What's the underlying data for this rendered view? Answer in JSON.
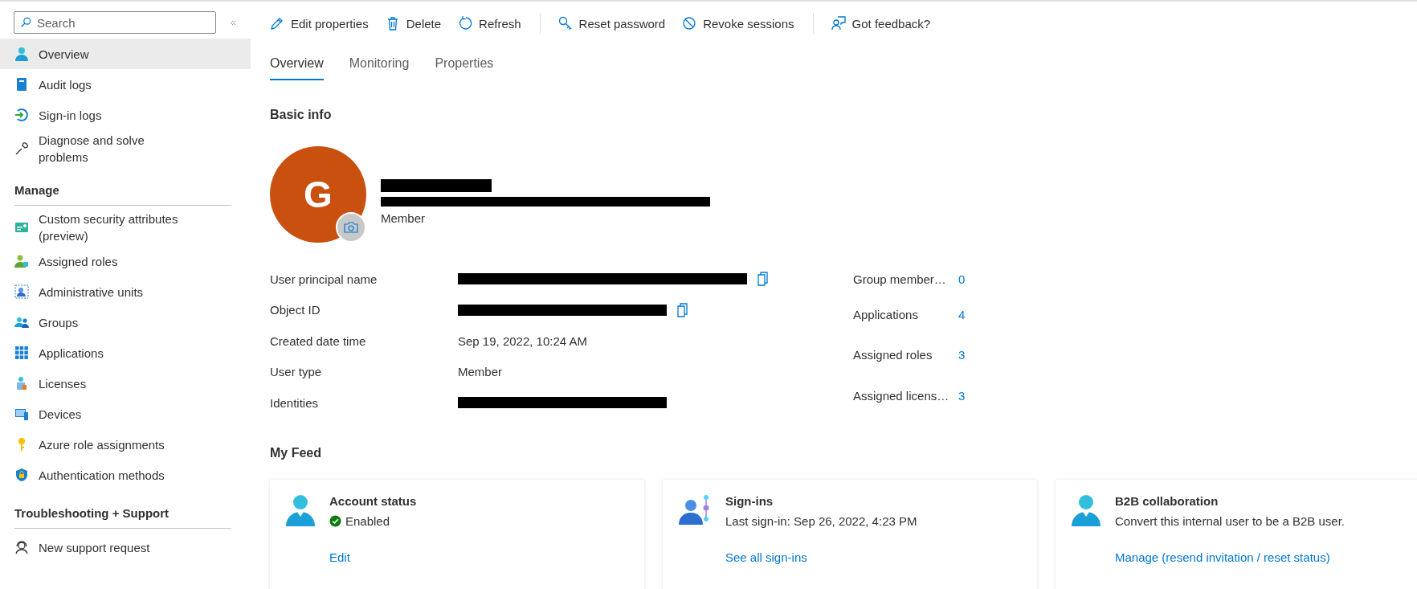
{
  "sidebar": {
    "search": {
      "placeholder": "Search"
    },
    "sections": [
      {
        "items": [
          {
            "label": "Overview",
            "selected": true
          },
          {
            "label": "Audit logs",
            "selected": false
          },
          {
            "label": "Sign-in logs",
            "selected": false
          },
          {
            "label": "Diagnose and solve problems",
            "selected": false
          }
        ]
      },
      {
        "heading": "Manage",
        "items": [
          {
            "label": "Custom security attributes (preview)",
            "selected": false
          },
          {
            "label": "Assigned roles",
            "selected": false
          },
          {
            "label": "Administrative units",
            "selected": false
          },
          {
            "label": "Groups",
            "selected": false
          },
          {
            "label": "Applications",
            "selected": false
          },
          {
            "label": "Licenses",
            "selected": false
          },
          {
            "label": "Devices",
            "selected": false
          },
          {
            "label": "Azure role assignments",
            "selected": false
          },
          {
            "label": "Authentication methods",
            "selected": false
          }
        ]
      },
      {
        "heading": "Troubleshooting + Support",
        "items": [
          {
            "label": "New support request",
            "selected": false
          }
        ]
      }
    ]
  },
  "toolbar": [
    [
      "Edit properties",
      "Delete",
      "Refresh"
    ],
    [
      "Reset password",
      "Revoke sessions"
    ],
    [
      "Got feedback?"
    ]
  ],
  "tabs": [
    {
      "label": "Overview",
      "selected": true
    },
    {
      "label": "Monitoring",
      "selected": false
    },
    {
      "label": "Properties",
      "selected": false
    }
  ],
  "basic_info": {
    "heading": "Basic info",
    "profile": {
      "initial": "G",
      "name_redacted": true,
      "email_redacted": true,
      "user_type": "Member"
    },
    "properties": [
      {
        "label": "User principal name",
        "redacted": true,
        "copyable": true
      },
      {
        "label": "Object ID",
        "redacted": true,
        "copyable": true
      },
      {
        "label": "Created date time",
        "value": "Sep 19, 2022, 10:24 AM",
        "redacted": false,
        "copyable": false
      },
      {
        "label": "User type",
        "value": "Member",
        "redacted": false,
        "copyable": false
      },
      {
        "label": "Identities",
        "redacted": true,
        "copyable": false
      }
    ],
    "counts": [
      {
        "label": "Group member…",
        "value": "0"
      },
      {
        "label": "Applications",
        "value": "4"
      },
      {
        "label": "Assigned roles",
        "value": "3"
      },
      {
        "label": "Assigned licens…",
        "value": "3"
      }
    ]
  },
  "feed": {
    "heading": "My Feed",
    "cards": [
      {
        "title": "Account status",
        "status": {
          "text": "Enabled",
          "enabled": true
        },
        "link": "Edit"
      },
      {
        "title": "Sign-ins",
        "description": "Last sign-in: Sep 26, 2022, 4:23 PM",
        "link": "See all sign-ins"
      },
      {
        "title": "B2B collaboration",
        "description": "Convert this internal user to be a B2B user.",
        "link": "Manage (resend invitation / reset status)"
      }
    ]
  }
}
